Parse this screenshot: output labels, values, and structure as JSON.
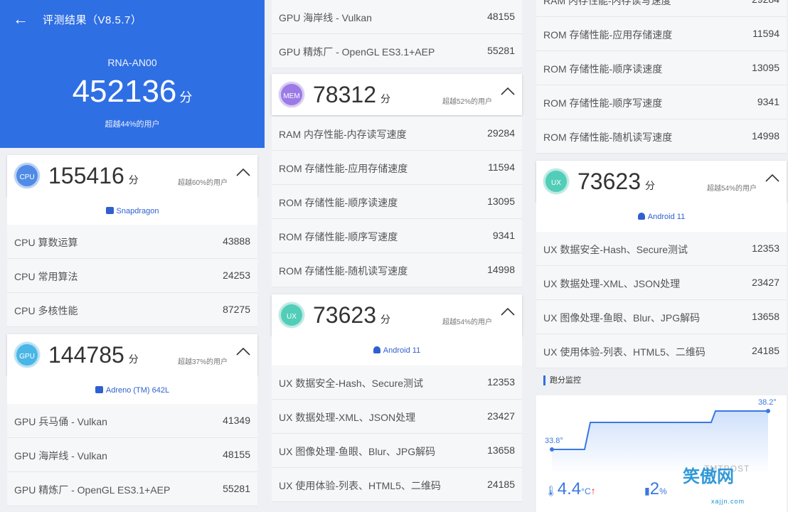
{
  "header": {
    "back_icon": "arrow-left-icon",
    "title": "评测结果（V8.5.7）",
    "device": "RNA-AN00",
    "total_score": "452136",
    "unit": "分",
    "beat": "超越44%的用户"
  },
  "cpu": {
    "badge": "CPU",
    "score": "155416",
    "unit": "分",
    "beat": "超越60%的用户",
    "chip": "Snapdragon",
    "rows": [
      {
        "label": "CPU 算数运算",
        "value": "43888"
      },
      {
        "label": "CPU 常用算法",
        "value": "24253"
      },
      {
        "label": "CPU 多核性能",
        "value": "87275"
      }
    ]
  },
  "gpu": {
    "badge": "GPU",
    "score": "144785",
    "unit": "分",
    "beat": "超越37%的用户",
    "chip": "Adreno (TM) 642L",
    "rows": [
      {
        "label": "GPU 兵马俑 - Vulkan",
        "value": "41349"
      },
      {
        "label": "GPU 海岸线 - Vulkan",
        "value": "48155"
      },
      {
        "label": "GPU 精炼厂 - OpenGL ES3.1+AEP",
        "value": "55281"
      }
    ]
  },
  "mem": {
    "badge": "MEM",
    "score": "78312",
    "unit": "分",
    "beat": "超越52%的用户",
    "rows": [
      {
        "label": "RAM 内存性能-内存读写速度",
        "value": "29284"
      },
      {
        "label": "ROM 存储性能-应用存储速度",
        "value": "11594"
      },
      {
        "label": "ROM 存储性能-顺序读速度",
        "value": "13095"
      },
      {
        "label": "ROM 存储性能-顺序写速度",
        "value": "9341"
      },
      {
        "label": "ROM 存储性能-随机读写速度",
        "value": "14998"
      }
    ],
    "partial_top": "RAM 内存性能-内存读写速度"
  },
  "ux": {
    "badge": "UX",
    "score": "73623",
    "unit": "分",
    "beat": "超越54%的用户",
    "chip": "Android 11",
    "rows": [
      {
        "label": "UX 数据安全-Hash、Secure测试",
        "value": "12353"
      },
      {
        "label": "UX 数据处理-XML、JSON处理",
        "value": "23427"
      },
      {
        "label": "UX 图像处理-鱼眼、Blur、JPG解码",
        "value": "13658"
      },
      {
        "label": "UX 使用体验-列表、HTML5、二维码",
        "value": "24185"
      }
    ]
  },
  "monitor": {
    "title": "跑分监控",
    "temp_start": "33.8°",
    "temp_end": "38.2°",
    "temp_rise": "4.4",
    "temp_unit": "°C",
    "temp_arrow": "↑",
    "battery_drop": "2",
    "battery_unit": "%"
  },
  "watermark": {
    "brand": "笑傲网",
    "site": "xajjn.com",
    "tm": "TMTPOST"
  },
  "colors": {
    "header_blue": "#2f6fe4",
    "cpu_badge": "#4f8be6",
    "gpu_badge": "#49b6e6",
    "mem_badge": "#9b7ae6",
    "ux_badge": "#52cdb8"
  }
}
